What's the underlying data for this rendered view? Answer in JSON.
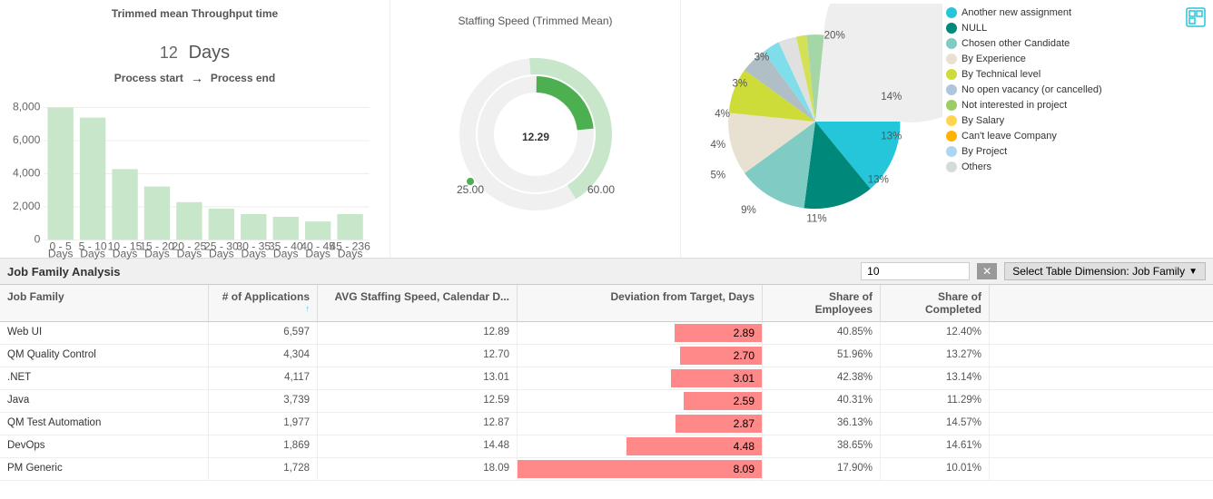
{
  "header": {
    "throughput_title": "Trimmed mean Throughput time",
    "throughput_value": "12",
    "throughput_unit": "Days",
    "process_start": "Process start",
    "process_end": "Process end",
    "arrow": "→"
  },
  "bar_chart": {
    "y_labels": [
      "0",
      "2,000",
      "4,000",
      "6,000",
      "8,000"
    ],
    "x_labels": [
      "0 - 5\nDays",
      "5 - 10\nDays",
      "10 - 15\nDays",
      "15 - 20\nDays",
      "20 - 25\nDays",
      "25 - 30\nDays",
      "30 - 35\nDays",
      "35 - 40\nDays",
      "40 - 45\nDays",
      "45 - 236\nDays"
    ],
    "values": [
      7800,
      6800,
      4200,
      3100,
      2200,
      1800,
      1500,
      1300,
      1100,
      1500
    ]
  },
  "gauge": {
    "title": "Staffing Speed (Trimmed Mean)",
    "value": "12.29",
    "min": "25.00",
    "max": "60.00"
  },
  "pie": {
    "segments": [
      {
        "label": "14%",
        "color": "#26C6DA",
        "value": 14,
        "angle_start": 0,
        "angle_end": 50
      },
      {
        "label": "13%",
        "color": "#009688",
        "value": 13
      },
      {
        "label": "13%",
        "color": "#80CBC4",
        "value": 13
      },
      {
        "label": "11%",
        "color": "#F5F5DC",
        "value": 11
      },
      {
        "label": "9%",
        "color": "#CDDC39",
        "value": 9
      },
      {
        "label": "5%",
        "color": "#B0BEC5",
        "value": 5
      },
      {
        "label": "4%",
        "color": "#80DEEA",
        "value": 4
      },
      {
        "label": "4%",
        "color": "#E0E0E0",
        "value": 4
      },
      {
        "label": "3%",
        "color": "#D4E157",
        "value": 3
      },
      {
        "label": "3%",
        "color": "#A5D6A7",
        "value": 3
      },
      {
        "label": "20%",
        "color": "#EEEEEE",
        "value": 20
      }
    ]
  },
  "legend": {
    "items": [
      {
        "label": "Another new assignment",
        "color": "#26C6DA"
      },
      {
        "label": "NULL",
        "color": "#009688"
      },
      {
        "label": "Chosen other Candidate",
        "color": "#80CBC4"
      },
      {
        "label": "By Experience",
        "color": "#F5F5DC"
      },
      {
        "label": "By Technical level",
        "color": "#CDDC39"
      },
      {
        "label": "No open vacancy (or cancelled)",
        "color": "#B0C4DE"
      },
      {
        "label": "Not interested in project",
        "color": "#9CCC65"
      },
      {
        "label": "By Salary",
        "color": "#FFD54F"
      },
      {
        "label": "Can't leave Company",
        "color": "#FFB300"
      },
      {
        "label": "By Project",
        "color": "#AED6F1"
      },
      {
        "label": "Others",
        "color": "#D5DBDB"
      }
    ]
  },
  "table": {
    "title": "Job Family Analysis",
    "filter_value": "10",
    "filter_placeholder": "10",
    "dimension_label": "Select Table Dimension: Job Family",
    "columns": [
      "Job Family",
      "# of Applications",
      "AVG Staffing Speed, Calendar D...",
      "Deviation from Target, Days",
      "Share of Employees",
      "Share of Completed"
    ],
    "sort_icon": "↑↓",
    "rows": [
      {
        "job": "Web UI",
        "apps": "6,597",
        "avg": "12.89",
        "dev": "2.89",
        "share_emp": "40.85%",
        "share_comp": "12.40%"
      },
      {
        "job": "QM Quality Control",
        "apps": "4,304",
        "avg": "12.70",
        "dev": "2.70",
        "share_emp": "51.96%",
        "share_comp": "13.27%"
      },
      {
        "job": ".NET",
        "apps": "4,117",
        "avg": "13.01",
        "dev": "3.01",
        "share_emp": "42.38%",
        "share_comp": "13.14%"
      },
      {
        "job": "Java",
        "apps": "3,739",
        "avg": "12.59",
        "dev": "2.59",
        "share_emp": "40.31%",
        "share_comp": "11.29%"
      },
      {
        "job": "QM Test Automation",
        "apps": "1,977",
        "avg": "12.87",
        "dev": "2.87",
        "share_emp": "36.13%",
        "share_comp": "14.57%"
      },
      {
        "job": "DevOps",
        "apps": "1,869",
        "avg": "14.48",
        "dev": "4.48",
        "share_emp": "38.65%",
        "share_comp": "14.61%"
      },
      {
        "job": "PM Generic",
        "apps": "1,728",
        "avg": "18.09",
        "dev": "8.09",
        "share_emp": "17.90%",
        "share_comp": "10.01%"
      }
    ]
  }
}
